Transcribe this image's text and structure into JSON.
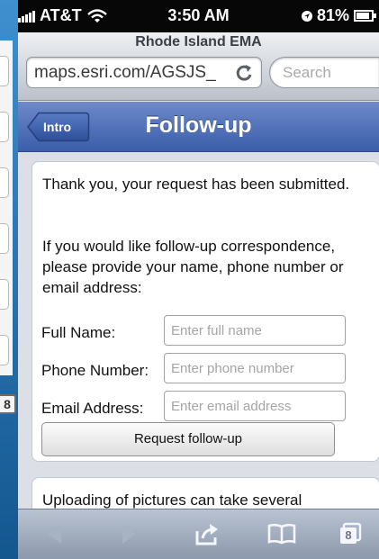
{
  "status_bar": {
    "carrier": "AT&T",
    "time": "3:50 AM",
    "battery": "81%"
  },
  "browser": {
    "page_title": "Rhode Island EMA",
    "url": "maps.esri.com/AGSJS_",
    "search_placeholder": "Search",
    "tab_count": "8"
  },
  "nav": {
    "back_label": "Intro",
    "title": "Follow-up",
    "color": "#4a6bb5"
  },
  "content": {
    "confirmation": "Thank you, your request has been submitted.",
    "instructions": "If you would like follow-up correspondence, please provide your name, phone number or email address:",
    "fields": [
      {
        "label": "Full Name:",
        "placeholder": "Enter full name",
        "value": ""
      },
      {
        "label": "Phone Number:",
        "placeholder": "Enter phone number",
        "value": ""
      },
      {
        "label": "Email Address:",
        "placeholder": "Enter email address",
        "value": ""
      }
    ],
    "submit_label": "Request follow-up",
    "next_card_text": "Uploading of pictures can take several"
  },
  "background_page": {
    "tab_count": "8"
  }
}
